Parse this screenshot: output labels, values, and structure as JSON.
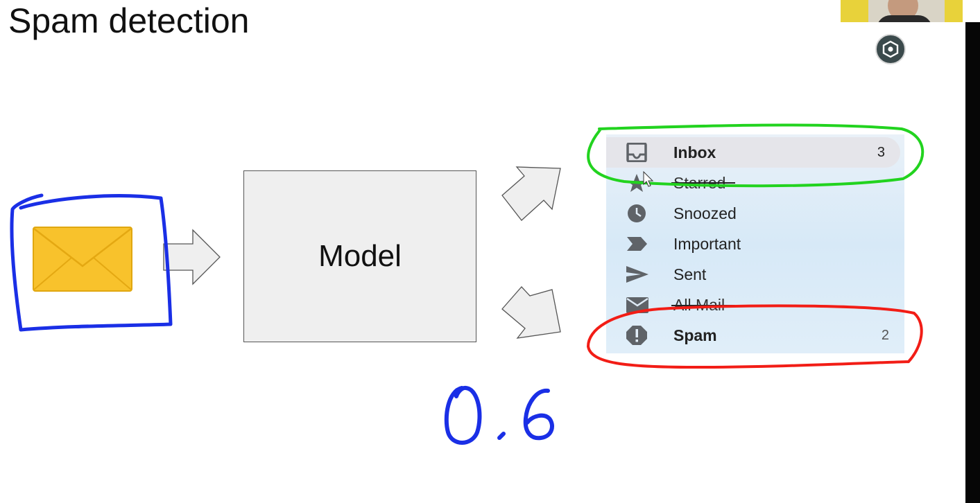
{
  "slide": {
    "title": "Spam detection"
  },
  "diagram": {
    "model_label": "Model",
    "handwritten_value": "0.6"
  },
  "mail_menu": {
    "items": [
      {
        "label": "Inbox",
        "count": "3",
        "icon": "inbox-icon",
        "bold": true,
        "selected": true
      },
      {
        "label": "Starred",
        "count": "",
        "icon": "star-icon"
      },
      {
        "label": "Snoozed",
        "count": "",
        "icon": "clock-icon"
      },
      {
        "label": "Important",
        "count": "",
        "icon": "important-icon"
      },
      {
        "label": "Sent",
        "count": "",
        "icon": "send-icon"
      },
      {
        "label": "All Mail",
        "count": "",
        "icon": "mail-icon"
      },
      {
        "label": "Spam",
        "count": "2",
        "icon": "spam-icon",
        "bold": true
      }
    ]
  },
  "annotations": {
    "email_circle_color": "#1a2fe6",
    "inbox_circle_color": "#22d31f",
    "spam_circle_color": "#f21d16",
    "value_color": "#1a2fe6"
  }
}
